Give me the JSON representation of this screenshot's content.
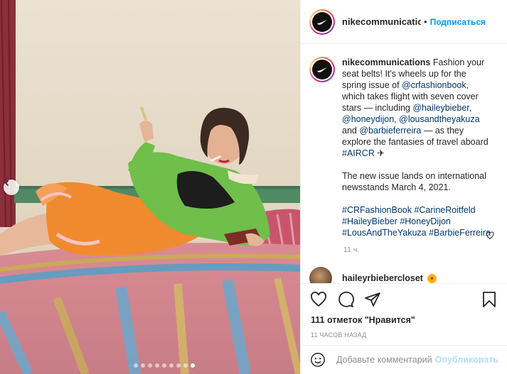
{
  "post": {
    "username": "nikecommunications",
    "separator": "•",
    "follow_label": "Подписаться"
  },
  "caption": {
    "username": "nikecommunications",
    "line1": "Fashion your seat belts! It's wheels up for the spring issue of ",
    "mention_crfashionbook": "@crfashionbook",
    "line2": ", which takes flight with seven cover stars — including ",
    "mention_haileybieber": "@haileybieber",
    "comma1": ", ",
    "mention_honeydijon": "@honeydijon",
    "comma2": ", ",
    "mention_lousandtheyakuza": "@lousandtheyakuza",
    "and": " and ",
    "mention_barbieferreira": "@barbieferreira",
    "line3": " — as they explore the fantasies of travel aboard ",
    "tag_aircr": "#AIRCR",
    "plane": " ✈",
    "paragraph2": "The new issue lands on international newsstands March 4, 2021.",
    "hashtags": [
      "#CRFashionBook",
      "#CarineRoitfeld",
      "#HaileyBieber",
      "#HoneyDijon",
      "#LousAndTheYakuza",
      "#BarbieFerreira"
    ],
    "time": "11 ч."
  },
  "comment": {
    "username": "haileyrbiebercloset",
    "emoji": "heart-eyes-emoji"
  },
  "stats": {
    "likes": "111 отметок \"Нравится\"",
    "time_ago": "11 ЧАСОВ НАЗАД"
  },
  "add_comment": {
    "placeholder": "Добавьте комментарий...",
    "publish_label": "Опубликовать"
  },
  "carousel": {
    "count": 9,
    "active_index": 8
  },
  "colors": {
    "accent": "#0095f6",
    "link": "#00376b",
    "publish_disabled": "#b2dffc",
    "muted": "#8e8e8e"
  },
  "icons": [
    "chevron-left-icon",
    "heart-icon",
    "comment-icon",
    "share-icon",
    "bookmark-icon",
    "emoji-icon",
    "small-heart-icon"
  ]
}
